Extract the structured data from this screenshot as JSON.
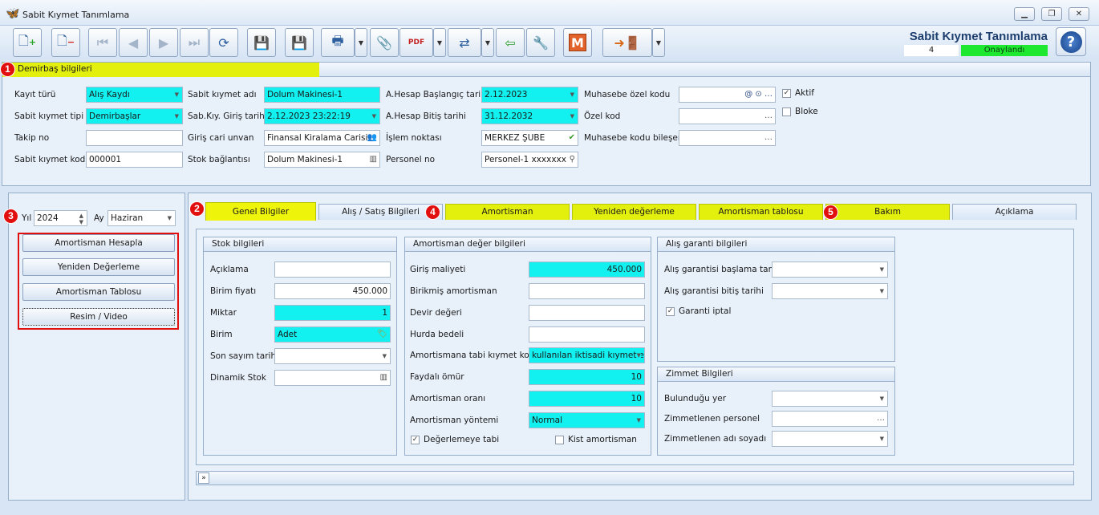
{
  "window": {
    "title": "Sabit Kıymet Tanımlama"
  },
  "header": {
    "app_title": "Sabit Kıymet Tanımlama",
    "record_no": "4",
    "status": "Onaylandı"
  },
  "toolbar": {
    "logo_letter": "M"
  },
  "badges": [
    "1",
    "2",
    "3",
    "4",
    "5"
  ],
  "demirbas": {
    "title": "Demirbaş bilgileri",
    "kayit_turu": {
      "label": "Kayıt türü",
      "value": "Alış Kaydı"
    },
    "sk_tipi": {
      "label": "Sabit kıymet tipi",
      "value": "Demirbaşlar"
    },
    "takip_no": {
      "label": "Takip no",
      "value": ""
    },
    "sk_kodu": {
      "label": "Sabit kıymet kodu",
      "value": "000001"
    },
    "sk_adi": {
      "label": "Sabit kıymet adı",
      "value": "Dolum Makinesi-1"
    },
    "giris_tarihi": {
      "label": "Sab.Kıy. Giriş tarihi",
      "value": "2.12.2023 23:22:19"
    },
    "cari_unvan": {
      "label": "Giriş cari unvan",
      "value": "Finansal Kiralama Carisi"
    },
    "stok_baglantisi": {
      "label": "Stok bağlantısı",
      "value": "Dolum Makinesi-1"
    },
    "ahesap_baslangic": {
      "label": "A.Hesap Başlangıç tarihi",
      "value": "2.12.2023"
    },
    "ahesap_bitis": {
      "label": "A.Hesap Bitiş tarihi",
      "value": "31.12.2032"
    },
    "islem_noktasi": {
      "label": "İşlem noktası",
      "value": "MERKEZ ŞUBE"
    },
    "personel_no": {
      "label": "Personel no",
      "value": "Personel-1 xxxxxxx"
    },
    "muh_ozel_kodu": {
      "label": "Muhasebe özel kodu",
      "value": ""
    },
    "ozel_kod": {
      "label": "Özel kod",
      "value": ""
    },
    "muh_kodu_bileseni": {
      "label": "Muhasebe kodu bileşeni",
      "value": ""
    },
    "aktif": {
      "label": "Aktif",
      "checked": true
    },
    "bloke": {
      "label": "Bloke",
      "checked": false
    }
  },
  "left": {
    "yil_label": "Yıl",
    "yil_value": "2024",
    "ay_label": "Ay",
    "ay_value": "Haziran",
    "buttons": [
      "Amortisman Hesapla",
      "Yeniden Değerleme",
      "Amortisman Tablosu",
      "Resim / Video"
    ]
  },
  "tabs": [
    "Genel Bilgiler",
    "Alış / Satış Bilgileri",
    "Amortisman",
    "Yeniden değerleme",
    "Amortisman tablosu",
    "Bakım",
    "Açıklama"
  ],
  "stok": {
    "title": "Stok bilgileri",
    "fields": [
      {
        "label": "Açıklama",
        "value": ""
      },
      {
        "label": "Birim fiyatı",
        "value": "450.000"
      },
      {
        "label": "Miktar",
        "value": "1"
      },
      {
        "label": "Birim",
        "value": "Adet"
      },
      {
        "label": "Son sayım tarihi",
        "value": ""
      },
      {
        "label": "Dinamik Stok",
        "value": ""
      }
    ]
  },
  "amortisman": {
    "title": "Amortisman değer bilgileri",
    "fields": [
      {
        "label": "Giriş maliyeti",
        "value": "450.000"
      },
      {
        "label": "Birikmiş amortisman",
        "value": ""
      },
      {
        "label": "Devir değeri",
        "value": ""
      },
      {
        "label": "Hurda bedeli",
        "value": ""
      },
      {
        "label": "Amortismana tabi kıymet kodu",
        "value": "kullanılan iktisadi kıymetler"
      },
      {
        "label": "Faydalı ömür",
        "value": "10"
      },
      {
        "label": "Amortisman oranı",
        "value": "10"
      },
      {
        "label": "Amortisman yöntemi",
        "value": "Normal"
      }
    ],
    "degerlemeye_tabi": {
      "label": "Değerlemeye tabi",
      "checked": true
    },
    "kist_amortisman": {
      "label": "Kist amortisman",
      "checked": false
    }
  },
  "garanti": {
    "title": "Alış garanti bilgileri",
    "baslama": {
      "label": "Alış garantisi başlama tarihi",
      "value": ""
    },
    "bitis": {
      "label": "Alış garantisi bitiş tarihi",
      "value": ""
    },
    "iptal": {
      "label": "Garanti iptal",
      "checked": true
    }
  },
  "zimmet": {
    "title": "Zimmet Bilgileri",
    "yer": {
      "label": "Bulunduğu yer",
      "value": ""
    },
    "personel": {
      "label": "Zimmetlenen personel",
      "value": ""
    },
    "adi_soyadi": {
      "label": "Zimmetlenen adı soyadı",
      "value": ""
    }
  },
  "colors": {
    "accent_cyan": "#13f0f0",
    "highlight_yellow": "#e3ef0c",
    "status_green": "#1ee82f",
    "badge_red": "#e20f0f"
  }
}
